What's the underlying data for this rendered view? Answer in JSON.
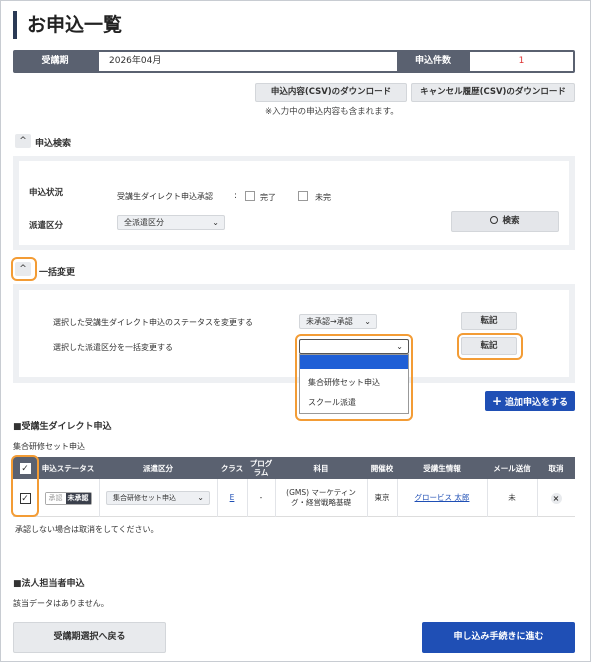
{
  "page": {
    "title": "お申込一覧"
  },
  "summary": {
    "period_label": "受講期",
    "period_value": "2026年04月",
    "count_label": "申込件数",
    "count_value": "1"
  },
  "downloads": {
    "csv_label": "申込内容(CSV)のダウンロード",
    "cancel_csv_label": "キャンセル履歴(CSV)のダウンロード",
    "note": "※入力中の申込内容も含まれます。"
  },
  "search": {
    "toggle": "^",
    "title": "申込検索",
    "status_label": "申込状況",
    "direct_label": "受講生ダイレクト申込承認",
    "colon": ":",
    "complete_label": "完了",
    "incomplete_label": "未完",
    "dispatch_label": "派遣区分",
    "dispatch_value": "全派遣区分",
    "search_button": "検索"
  },
  "bulk": {
    "toggle": "^",
    "title": "一括変更",
    "row1_label": "選択した受講生ダイレクト申込のステータスを変更する",
    "row1_select": "未承認→承認",
    "row1_button": "転記",
    "row2_label": "選択した派遣区分を一括変更する",
    "row2_select": "",
    "row2_button": "転記",
    "dropdown_options": [
      "",
      "集合研修セット申込",
      "スクール派遣"
    ]
  },
  "add_button": "追加申込をする",
  "direct": {
    "title": "■受講生ダイレクト申込",
    "subtitle": "集合研修セット申込",
    "headers": [
      "申込ステータス",
      "派遣区分",
      "クラス",
      "プログラム",
      "科目",
      "開催校",
      "受講生情報",
      "メール送信",
      "取消"
    ],
    "row": {
      "toggle_off": "承認",
      "toggle_on": "未承認",
      "dispatch": "集合研修セット申込",
      "class": "E",
      "program": "-",
      "subject": "(GMS) マーケティング・経営戦略基礎",
      "school": "東京",
      "student": "グロービス 太郎",
      "mail": "未",
      "cancel": "×"
    },
    "note": "承認しない場合は取消をしてください。"
  },
  "corporate": {
    "title": "■法人担当者申込",
    "empty": "該当データはありません。"
  },
  "footer": {
    "back_button": "受講期選択へ戻る",
    "next_button": "申し込み手続きに進む"
  }
}
